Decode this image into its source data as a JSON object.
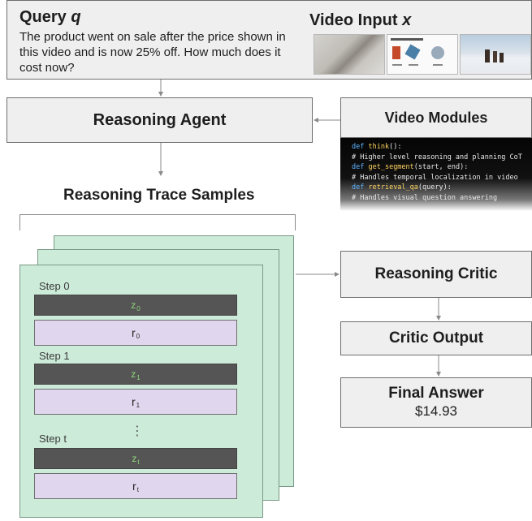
{
  "query": {
    "title_main": "Query ",
    "title_var": "q",
    "text": "The product went on sale after the price shown in this video and is now 25% off. How much does it cost now?"
  },
  "video": {
    "title_main": "Video Input ",
    "title_var": "x",
    "thumbnails": [
      "video-frame-1",
      "video-frame-2",
      "video-frame-3",
      "video-frame-4"
    ]
  },
  "agent": {
    "label": "Reasoning Agent"
  },
  "modules": {
    "header": "Video Modules",
    "code": [
      {
        "kw": "def ",
        "fn": "think",
        "rest": "():"
      },
      {
        "comment": "# Higher level reasoning and planning CoT"
      },
      {
        "kw": "def ",
        "fn": "get_segment",
        "rest": "(start, end):"
      },
      {
        "comment": "# Handles temporal localization in video"
      },
      {
        "kw": "def ",
        "fn": "retrieval_qa",
        "rest": "(query):"
      },
      {
        "comment": "# Handles visual question answering"
      }
    ]
  },
  "trace": {
    "title": "Reasoning Trace Samples",
    "steps": [
      {
        "label": "Step 0",
        "z": "z",
        "z_sub": "0",
        "r": "r",
        "r_sub": "0"
      },
      {
        "label": "Step 1",
        "z": "z",
        "z_sub": "1",
        "r": "r",
        "r_sub": "1"
      },
      {
        "label": "Step t",
        "z": "z",
        "z_sub": "t",
        "r": "r",
        "r_sub": "t"
      }
    ],
    "ellipsis": "⋮"
  },
  "critic": {
    "label": "Reasoning Critic"
  },
  "critic_output": {
    "label": "Critic Output"
  },
  "final": {
    "title": "Final Answer",
    "value": "$14.93"
  },
  "colors": {
    "box_fill": "#efefef",
    "card_fill": "#cdebd9",
    "z_fill": "#555555",
    "z_text": "#8fd67a",
    "r_fill": "#e0d7ee"
  }
}
